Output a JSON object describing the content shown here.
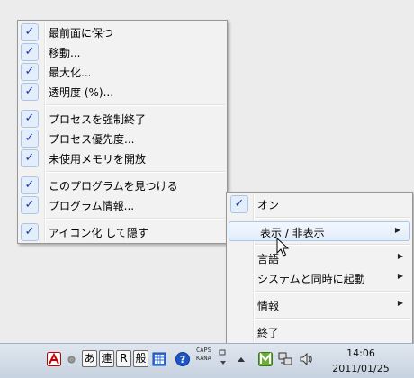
{
  "left_menu": {
    "items": [
      {
        "label": "最前面に保つ",
        "checked": true
      },
      {
        "label": "移動...",
        "checked": true
      },
      {
        "label": "最大化...",
        "checked": true
      },
      {
        "label": "透明度 (%)...",
        "checked": true
      },
      {
        "label": "プロセスを強制終了",
        "checked": true
      },
      {
        "label": "プロセス優先度...",
        "checked": true
      },
      {
        "label": "未使用メモリを開放",
        "checked": true
      },
      {
        "label": "このプログラムを見つける",
        "checked": true
      },
      {
        "label": "プログラム情報...",
        "checked": true
      },
      {
        "label": "アイコン化 して隠す",
        "checked": true
      }
    ]
  },
  "right_menu": {
    "items": [
      {
        "label": "オン",
        "checked": true
      },
      {
        "label": "表示 / 非表示",
        "submenu": true,
        "highlighted": true
      },
      {
        "label": "言語",
        "submenu": true
      },
      {
        "label": "システムと同時に起動",
        "submenu": true
      },
      {
        "label": "情報",
        "submenu": true
      },
      {
        "label": "終了"
      }
    ]
  },
  "taskbar": {
    "ime": [
      "あ",
      "連",
      "R",
      "般"
    ],
    "caps_label": "CAPS",
    "kana_label": "KANA",
    "time": "14:06",
    "date": "2011/01/25"
  },
  "icons": {
    "check": "✓",
    "arrow": "▶"
  }
}
